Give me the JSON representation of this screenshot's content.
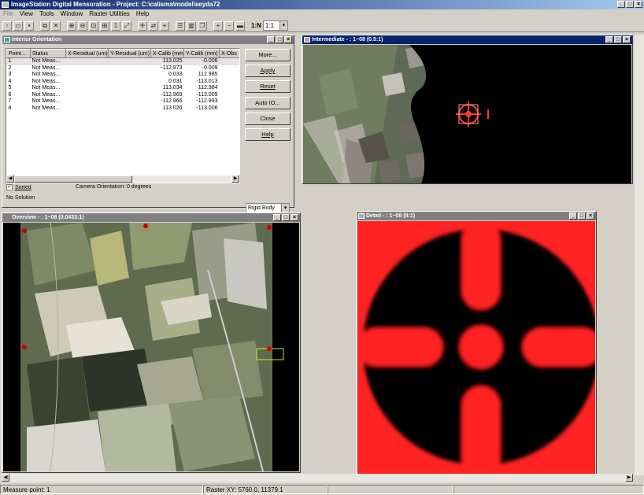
{
  "app": {
    "title": "ImageStation Digital Mensuration - Project: C:\\calisma\\model\\seyda72"
  },
  "window_buttons": {
    "minimize": "_",
    "maximize": "□",
    "close": "×"
  },
  "menu": [
    {
      "label": "File",
      "disabled": true
    },
    {
      "label": "View"
    },
    {
      "label": "Tools"
    },
    {
      "label": "Window"
    },
    {
      "label": "Raster Utilities"
    },
    {
      "label": "Help"
    }
  ],
  "toolbar": {
    "zoom_label": "1:N",
    "zoom_value": "1:1",
    "icons": [
      "new-icon",
      "open-icon",
      "save-icon",
      "copy-icon",
      "delete-icon",
      "zoom-in-icon",
      "zoom-out-icon",
      "zoom-window-icon",
      "zoom-fit-icon",
      "zoom-1to1-icon",
      "roam-icon",
      "crosshair-icon",
      "swap-icon",
      "measure-icon",
      "tile-horizontal-icon",
      "tile-vertical-icon",
      "cascade-icon",
      "zoom-in-small-icon",
      "zoom-out-small-icon",
      "layer-icon"
    ]
  },
  "io": {
    "title": "Interior Orientation",
    "columns": [
      "Point...",
      "Status",
      "X-Residual (um)",
      "Y-Residual (um)",
      "X-Calib (mm)",
      "Y-Calib (mm)",
      "X-Obs"
    ],
    "rows": [
      [
        "1",
        "Not Meas...",
        "",
        "",
        "113.025",
        "-0.006"
      ],
      [
        "2",
        "Not Meas...",
        "",
        "",
        "-112.973",
        "-0.009"
      ],
      [
        "3",
        "Not Meas...",
        "",
        "",
        "0.033",
        "112.985"
      ],
      [
        "4",
        "Not Meas...",
        "",
        "",
        "0.031",
        "-113.013"
      ],
      [
        "5",
        "Not Meas...",
        "",
        "",
        "113.034",
        "112.984"
      ],
      [
        "6",
        "Not Meas...",
        "",
        "",
        "-112.969",
        "-113.009"
      ],
      [
        "7",
        "Not Meas...",
        "",
        "",
        "-112.966",
        "-112.993"
      ],
      [
        "8",
        "Not Meas...",
        "",
        "",
        "113.026",
        "-113.006"
      ]
    ],
    "buttons": [
      "More...",
      "Apply",
      "Reset",
      "Auto IO...",
      "Close",
      "Help"
    ],
    "sorted_label": "Sorted",
    "sorted_checked": true,
    "camera_orientation": "Camera Orientation: 0 degrees",
    "solution": "No Solution",
    "transform": "Rigid Body"
  },
  "intermediate": {
    "title": "Intermediate - : 1~08  (0.5:1)"
  },
  "overview": {
    "title": "Overview - : 1~08  (0.0433:1)"
  },
  "detail": {
    "title": "Detail - : 1~08  (8:1)"
  },
  "status": {
    "measure": "Measure point: 1",
    "raster": "Raster XY: 5760.0, 11379.1"
  },
  "colors": {
    "title_active": "#0a246a",
    "title_inactive": "#808080",
    "fiducial": "#ff2020"
  }
}
